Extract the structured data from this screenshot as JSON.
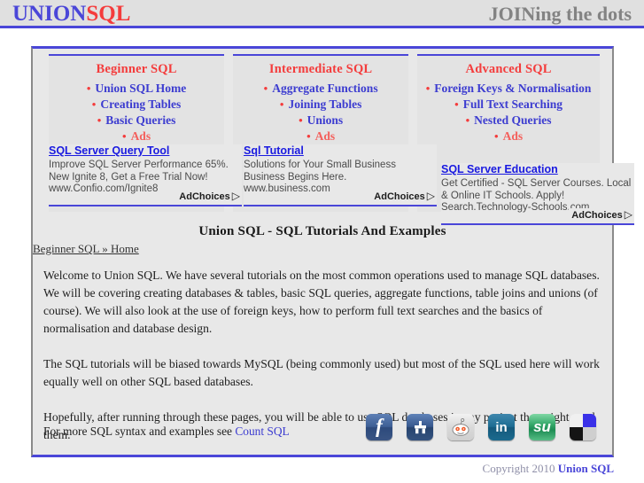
{
  "header": {
    "logo_union": "UNION",
    "logo_sql": "SQL",
    "tagline": "JOINing the dots"
  },
  "nav": {
    "columns": [
      {
        "title": "Beginner SQL",
        "items": [
          "Union SQL Home",
          "Creating Tables",
          "Basic Queries",
          "Ads"
        ]
      },
      {
        "title": "Intermediate SQL",
        "items": [
          "Aggregate Functions",
          "Joining Tables",
          "Unions",
          "Ads"
        ]
      },
      {
        "title": "Advanced SQL",
        "items": [
          "Foreign Keys & Normalisation",
          "Full Text Searching",
          "Nested Queries",
          "Ads"
        ]
      }
    ]
  },
  "ads": {
    "adchoices_label": "AdChoices",
    "adchoices_glyph": "▷",
    "blocks": [
      {
        "title": "SQL Server Query Tool",
        "desc": "Improve SQL Server Performance 65%. New Ignite 8, Get a Free Trial Now!",
        "url": "www.Confio.com/Ignite8"
      },
      {
        "title": "Sql Tutorial",
        "desc": "Solutions for Your Small Business Business Begins Here.",
        "url": "www.business.com"
      },
      {
        "title": "SQL Server Education",
        "desc": "Get Certified - SQL Server Courses. Local & Online IT Schools. Apply!",
        "url": "Search.Technology-Schools.com"
      }
    ]
  },
  "main": {
    "page_title": "Union SQL - SQL Tutorials And Examples",
    "breadcrumb": "Beginner SQL » Home",
    "paragraphs": [
      "Welcome to Union SQL. We have several tutorials on the most common operations used to manage SQL databases. We will be covering creating databases & tables, basic SQL queries, aggregate functions, table joins and unions (of course). We will also look at the use of foreign keys, how to perform full text searches and the basics of normalisation and database design.",
      "The SQL tutorials will be biased towards MySQL (being commonly used) but most of the SQL used here will work equally well on other SQL based databases.",
      "Hopefully, after running through these pages, you will be able to use SQL databases in any project that might need them."
    ]
  },
  "footer": {
    "text_prefix": "For more SQL syntax and examples see ",
    "link_label": "Count SQL",
    "social": [
      {
        "name": "facebook",
        "glyph": "f"
      },
      {
        "name": "delicious",
        "glyph": "⛾"
      },
      {
        "name": "reddit",
        "glyph": ""
      },
      {
        "name": "linkedin",
        "glyph": "in"
      },
      {
        "name": "stumbleupon",
        "glyph": "su"
      },
      {
        "name": "windows-live",
        "glyph": ""
      }
    ],
    "copyright_text": "Copyright 2010 ",
    "copyright_brand": "Union SQL"
  },
  "colors": {
    "accent_blue": "#4a46d8",
    "accent_red": "#f43c3c",
    "link_blue": "#3c3cd0",
    "page_bg": "#e8e8e8",
    "header_bg": "#e0e0e0"
  }
}
